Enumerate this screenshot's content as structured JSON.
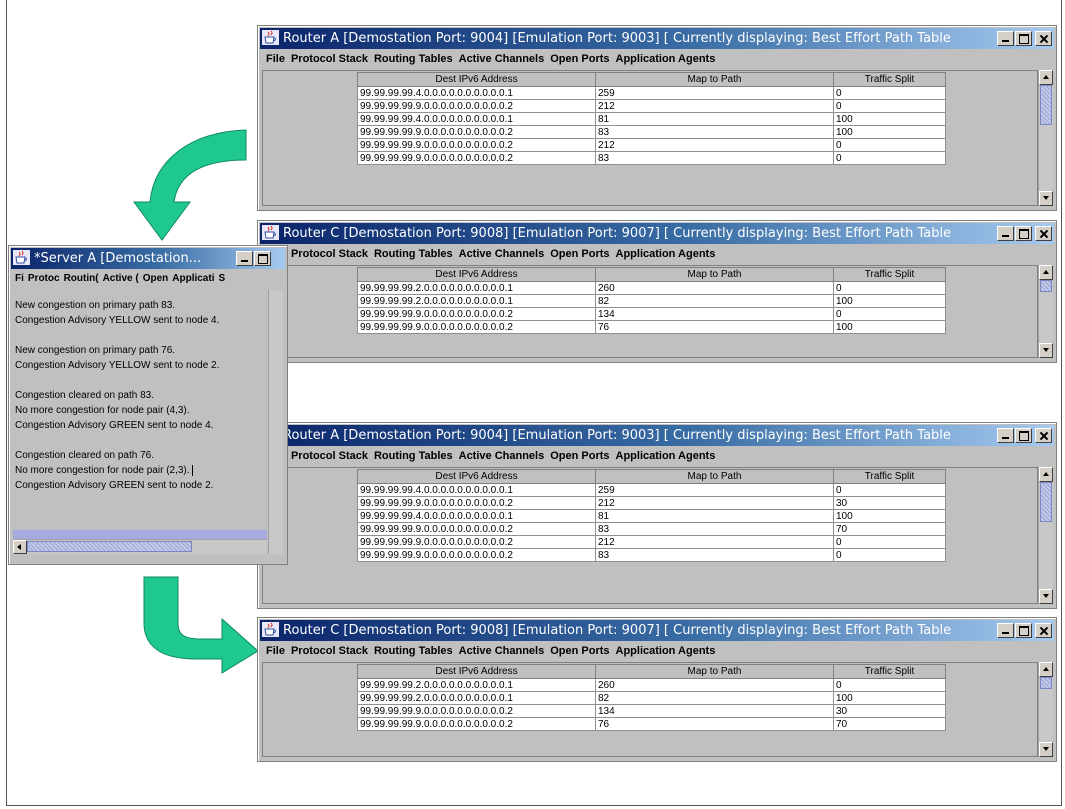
{
  "colors": {
    "arrow": "#1fc88e",
    "titlebar": "#0a246a",
    "window_bg": "#c0c0c0"
  },
  "icons": {
    "window": "java-cup-icon"
  },
  "menu_labels": [
    "File",
    "Protocol Stack",
    "Routing Tables",
    "Active Channels",
    "Open Ports",
    "Application Agents"
  ],
  "table_headers": [
    "Dest IPv6 Address",
    "Map to Path",
    "Traffic Split"
  ],
  "windows": [
    {
      "title": "Router A    [Demostation Port: 9004]  [Emulation Port: 9003]  [ Currently displaying: Best Effort Path Table",
      "rows": [
        [
          "99.99.99.99.4.0.0.0.0.0.0.0.0.0.0.1",
          "259",
          "0"
        ],
        [
          "99.99.99.99.9.0.0.0.0.0.0.0.0.0.0.2",
          "212",
          "0"
        ],
        [
          "99.99.99.99.4.0.0.0.0.0.0.0.0.0.0.1",
          "81",
          "100"
        ],
        [
          "99.99.99.99.9.0.0.0.0.0.0.0.0.0.0.2",
          "83",
          "100"
        ],
        [
          "99.99.99.99.9.0.0.0.0.0.0.0.0.0.0.2",
          "212",
          "0"
        ],
        [
          "99.99.99.99.9.0.0.0.0.0.0.0.0.0.0.2",
          "83",
          "0"
        ]
      ]
    },
    {
      "title": "Router C    [Demostation Port: 9008]  [Emulation Port: 9007]  [ Currently displaying: Best Effort Path Table",
      "rows": [
        [
          "99.99.99.99.2.0.0.0.0.0.0.0.0.0.0.1",
          "260",
          "0"
        ],
        [
          "99.99.99.99.2.0.0.0.0.0.0.0.0.0.0.1",
          "82",
          "100"
        ],
        [
          "99.99.99.99.9.0.0.0.0.0.0.0.0.0.0.2",
          "134",
          "0"
        ],
        [
          "99.99.99.99.9.0.0.0.0.0.0.0.0.0.0.2",
          "76",
          "100"
        ]
      ]
    },
    {
      "title": "Router A    [Demostation Port: 9004]  [Emulation Port: 9003]  [ Currently displaying: Best Effort Path Table",
      "rows": [
        [
          "99.99.99.99.4.0.0.0.0.0.0.0.0.0.0.1",
          "259",
          "0"
        ],
        [
          "99.99.99.99.9.0.0.0.0.0.0.0.0.0.0.2",
          "212",
          "30"
        ],
        [
          "99.99.99.99.4.0.0.0.0.0.0.0.0.0.0.1",
          "81",
          "100"
        ],
        [
          "99.99.99.99.9.0.0.0.0.0.0.0.0.0.0.2",
          "83",
          "70"
        ],
        [
          "99.99.99.99.9.0.0.0.0.0.0.0.0.0.0.2",
          "212",
          "0"
        ],
        [
          "99.99.99.99.9.0.0.0.0.0.0.0.0.0.0.2",
          "83",
          "0"
        ]
      ]
    },
    {
      "title": "Router C    [Demostation Port: 9008]  [Emulation Port: 9007]  [ Currently displaying: Best Effort Path Table",
      "rows": [
        [
          "99.99.99.99.2.0.0.0.0.0.0.0.0.0.0.1",
          "260",
          "0"
        ],
        [
          "99.99.99.99.2.0.0.0.0.0.0.0.0.0.0.1",
          "82",
          "100"
        ],
        [
          "99.99.99.99.9.0.0.0.0.0.0.0.0.0.0.2",
          "134",
          "30"
        ],
        [
          "99.99.99.99.9.0.0.0.0.0.0.0.0.0.0.2",
          "76",
          "70"
        ]
      ]
    }
  ],
  "server": {
    "title": "*Server A    [Demostation...",
    "menu": [
      "Fi",
      "Protoc",
      "Routin(",
      "Active (",
      "Open",
      "Applicati",
      "S"
    ],
    "log": [
      "New congestion on primary path 83.",
      "Congestion Advisory YELLOW sent to node 4.",
      "",
      "New congestion on primary path 76.",
      "Congestion Advisory YELLOW sent to node 2.",
      "",
      "Congestion cleared on path 83.",
      "No more congestion for node pair (4,3).",
      "Congestion Advisory GREEN sent to node 4.",
      "",
      "Congestion cleared on path 76.",
      "No more congestion for node pair (2,3).",
      "Congestion Advisory GREEN sent to node 2."
    ]
  }
}
